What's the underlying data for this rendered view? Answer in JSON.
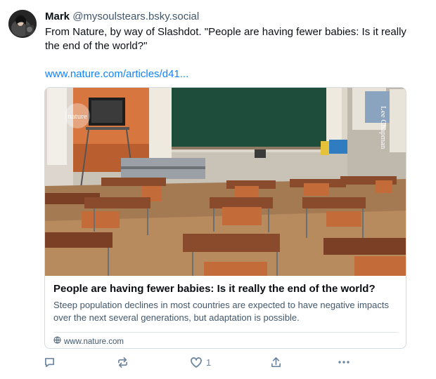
{
  "post": {
    "author_name": "Mark",
    "author_handle": "@mysoulstears.bsky.social",
    "text_line1": "From Nature, by way of Slashdot. \"People are having fewer babies: Is it really the end of the world?\"",
    "link_text": "www.nature.com/articles/d41..."
  },
  "card": {
    "image_watermark": "nature",
    "image_credit": "Lee Chapman",
    "title": "People are having fewer babies: Is it really the end of the world?",
    "description": "Steep population declines in most countries are expected to have negative impacts over the next several generations, but adaptation is possible.",
    "domain": "www.nature.com"
  },
  "actions": {
    "reply_icon": "reply-icon",
    "repost_icon": "repost-icon",
    "like_icon": "heart-icon",
    "like_count": "1",
    "share_icon": "share-icon",
    "more_icon": "more-icon"
  },
  "colors": {
    "link": "#1083fe",
    "muted": "#42576c",
    "icon": "#6f869f",
    "border": "#d4dbe2"
  }
}
